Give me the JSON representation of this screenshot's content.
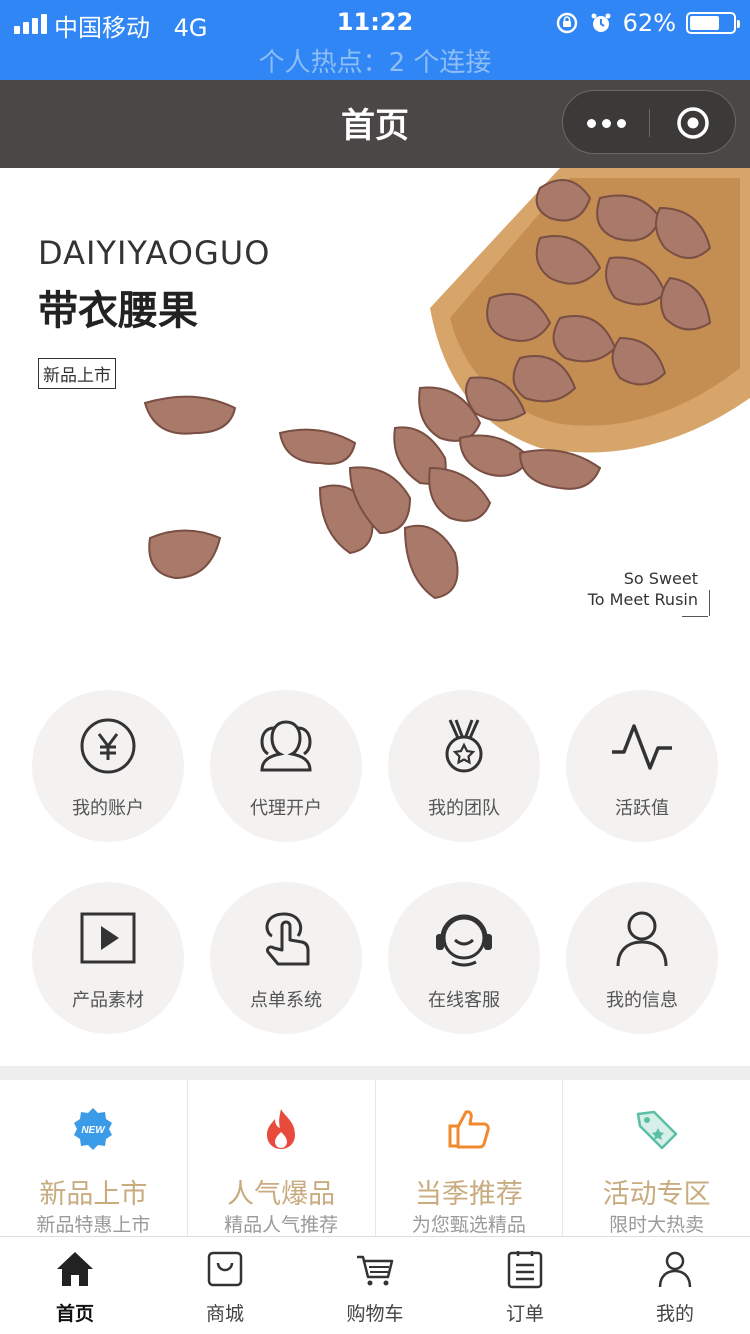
{
  "status_bar": {
    "carrier": "中国移动",
    "network": "4G",
    "time": "11:22",
    "battery": "62%",
    "battery_level": 0.62,
    "hotspot": "个人热点：2 个连接"
  },
  "nav": {
    "title": "首页"
  },
  "banner": {
    "brand_en": "DAIYIYAOGUO",
    "brand_cn": "带衣腰果",
    "tag": "新品上市",
    "slogan_1": "So Sweet",
    "slogan_2": "To Meet Rusin"
  },
  "menu": [
    {
      "label": "我的账户",
      "icon": "yen-icon"
    },
    {
      "label": "代理开户",
      "icon": "users-icon"
    },
    {
      "label": "我的团队",
      "icon": "medal-icon"
    },
    {
      "label": "活跃值",
      "icon": "pulse-icon"
    },
    {
      "label": "产品素材",
      "icon": "play-icon"
    },
    {
      "label": "点单系统",
      "icon": "tap-icon"
    },
    {
      "label": "在线客服",
      "icon": "headset-icon"
    },
    {
      "label": "我的信息",
      "icon": "person-icon"
    }
  ],
  "categories": [
    {
      "title": "新品上市",
      "subtitle": "新品特惠上市",
      "icon": "new-badge-icon",
      "color": "#3a9be8"
    },
    {
      "title": "人气爆品",
      "subtitle": "精品人气推荐",
      "icon": "fire-icon",
      "color": "#e84a3c"
    },
    {
      "title": "当季推荐",
      "subtitle": "为您甄选精品",
      "icon": "thumbs-up-icon",
      "color": "#f08a2c"
    },
    {
      "title": "活动专区",
      "subtitle": "限时大热卖",
      "icon": "price-tag-icon",
      "color": "#5bbfa6"
    }
  ],
  "tabbar": [
    {
      "label": "首页",
      "icon": "home-icon",
      "active": true
    },
    {
      "label": "商城",
      "icon": "shopping-bag-icon",
      "active": false
    },
    {
      "label": "购物车",
      "icon": "cart-icon",
      "active": false
    },
    {
      "label": "订单",
      "icon": "order-list-icon",
      "active": false
    },
    {
      "label": "我的",
      "icon": "user-icon",
      "active": false
    }
  ],
  "colors": {
    "status_bar": "#2f86f4",
    "nav_bar": "#4a4746",
    "category_title": "#c9ab80"
  }
}
